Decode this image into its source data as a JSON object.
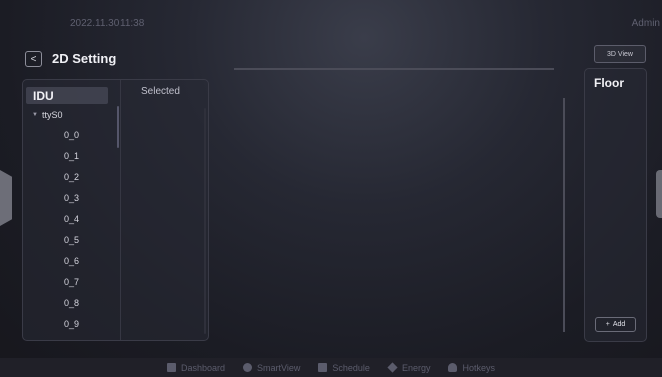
{
  "topbar": {
    "date": "2022.11.30",
    "time": "11:38",
    "user": "Admin"
  },
  "header": {
    "back_glyph": "<",
    "title": "2D Setting"
  },
  "idu_panel": {
    "title": "IDU",
    "selected_label": "Selected",
    "group": {
      "caret_glyph": "▼",
      "label": "ttyS0"
    },
    "items": [
      "0_0",
      "0_1",
      "0_2",
      "0_3",
      "0_4",
      "0_5",
      "0_6",
      "0_7",
      "0_8",
      "0_9"
    ]
  },
  "view_button": {
    "label": "3D View"
  },
  "floor_panel": {
    "title": "Floor",
    "add_glyph": "+",
    "add_label": "Add"
  },
  "bottom_nav": [
    {
      "label": "Dashboard",
      "icon": "dashboard-icon"
    },
    {
      "label": "SmartView",
      "icon": "smartview-icon"
    },
    {
      "label": "Schedule",
      "icon": "schedule-icon"
    },
    {
      "label": "Energy",
      "icon": "energy-icon"
    },
    {
      "label": "Hotkeys",
      "icon": "hotkeys-icon"
    }
  ],
  "colors": {
    "background": "#1b1c24",
    "panel": "#282a34",
    "text": "#e8e8ee",
    "muted": "#5b5c6c"
  }
}
